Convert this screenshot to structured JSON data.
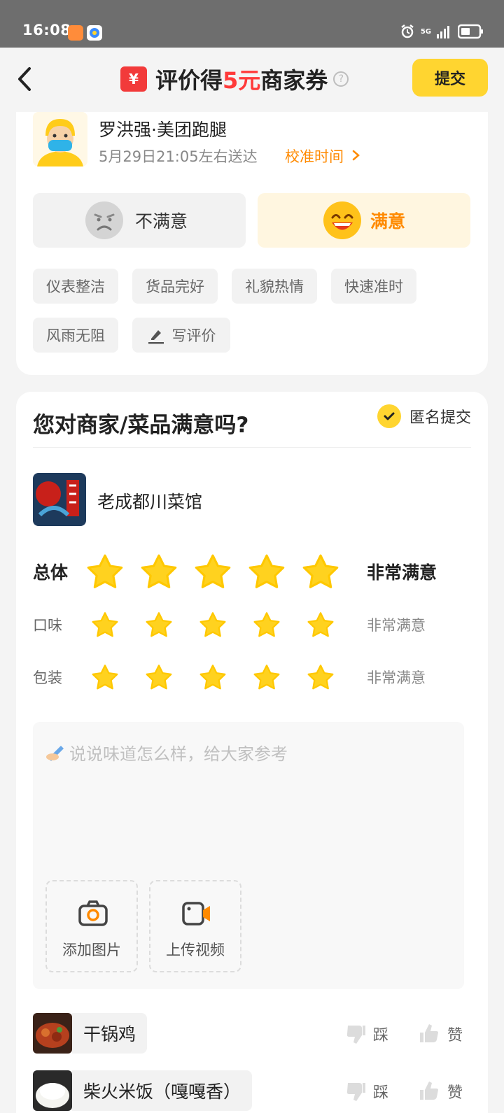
{
  "status_bar": {
    "time": "16:08",
    "network": "5G"
  },
  "header": {
    "coupon_symbol": "¥",
    "title_prefix": "评价得",
    "title_highlight": "5元",
    "title_suffix": "商家券",
    "help_symbol": "?",
    "submit_label": "提交"
  },
  "delivery": {
    "courier": "罗洪强·美团跑腿",
    "eta": "5月29日21:05左右送达",
    "calibrate_label": "校准时间",
    "dissatisfied_label": "不满意",
    "satisfied_label": "满意",
    "selected": "满意",
    "tags": [
      "仪表整洁",
      "货品完好",
      "礼貌热情",
      "快速准时",
      "风雨无阻"
    ],
    "write_review_label": "写评价"
  },
  "merchant": {
    "question": "您对商家/菜品满意吗?",
    "anonymous_label": "匿名提交",
    "anonymous_checked": true,
    "shop_name": "老成都川菜馆",
    "ratings": [
      {
        "label": "总体",
        "stars": 5,
        "result": "非常满意"
      },
      {
        "label": "口味",
        "stars": 5,
        "result": "非常满意"
      },
      {
        "label": "包装",
        "stars": 5,
        "result": "非常满意"
      }
    ],
    "review_placeholder": "说说味道怎么样，给大家参考",
    "add_photo_label": "添加图片",
    "upload_video_label": "上传视频"
  },
  "dishes": [
    {
      "name": "干锅鸡",
      "dislike_label": "踩",
      "like_label": "赞"
    },
    {
      "name": "柴火米饭（嘎嘎香）",
      "dislike_label": "踩",
      "like_label": "赞"
    }
  ],
  "colors": {
    "accent": "#ffd530",
    "highlight": "#ff3a3a",
    "orange": "#ff8a00",
    "star": "#ffd21f"
  }
}
